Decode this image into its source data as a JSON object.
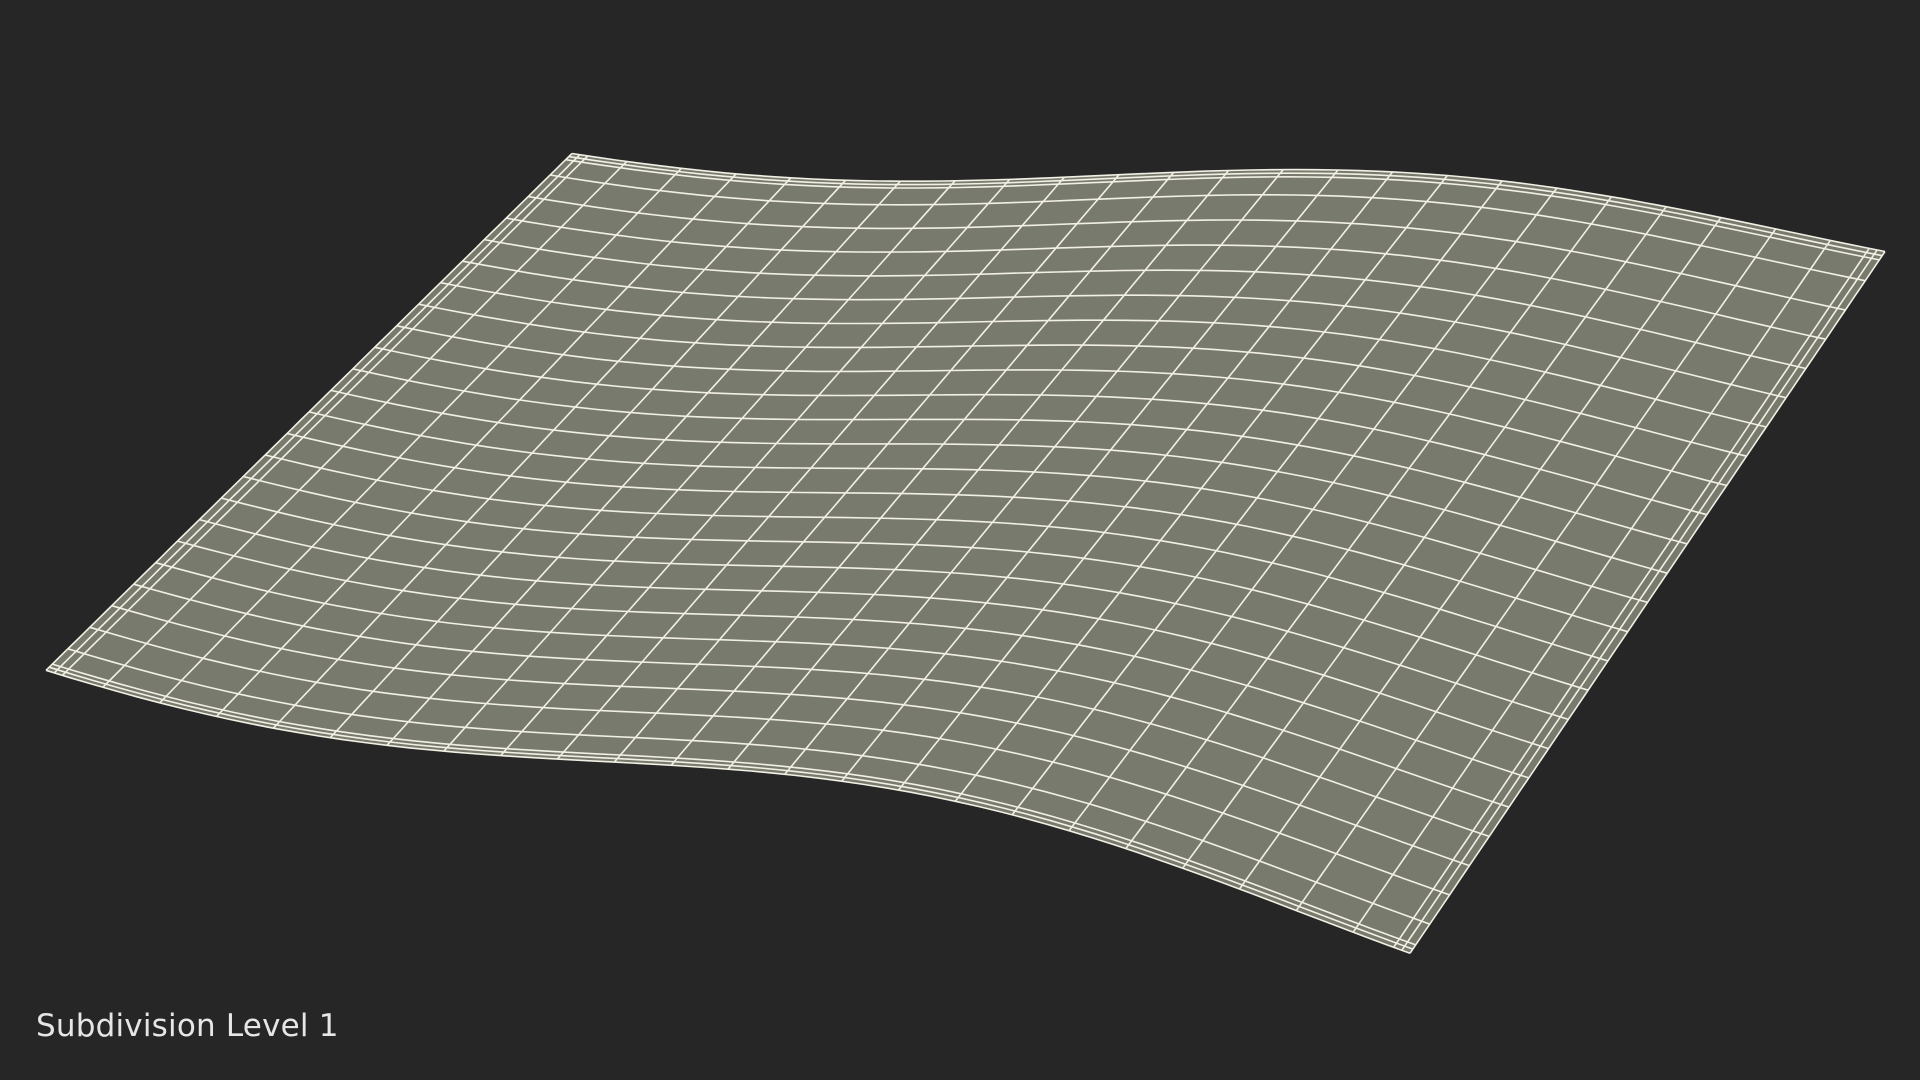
{
  "viewport": {
    "background_color": "#262626",
    "mesh_fill_color": "#797a6e",
    "wire_color": "#f2f0e4",
    "mesh_name": "wavy-subdivided-plane",
    "subdivision_level": 1
  },
  "caption": {
    "text": "Subdivision Level 1"
  }
}
